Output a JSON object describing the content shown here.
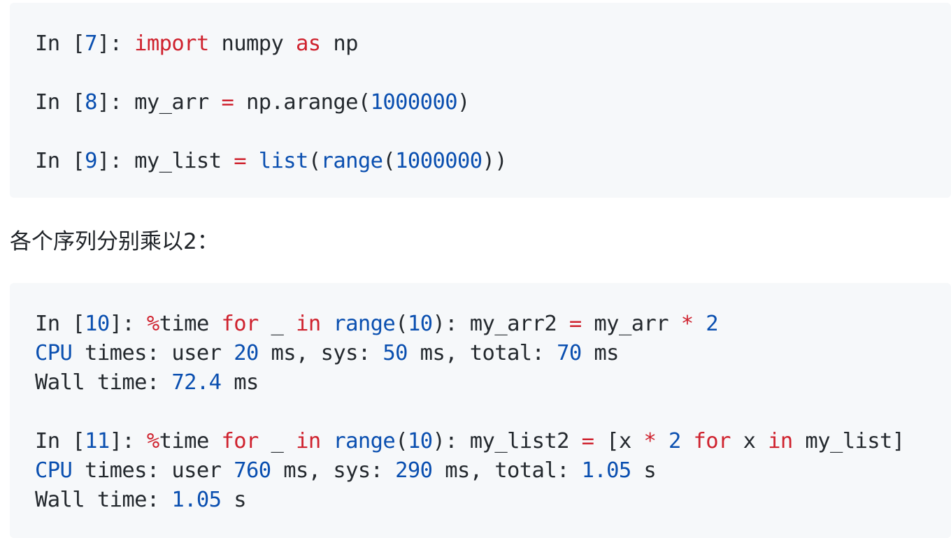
{
  "block1": {
    "lines": [
      [
        {
          "t": "In [",
          "c": "txt"
        },
        {
          "t": "7",
          "c": "num"
        },
        {
          "t": "]: ",
          "c": "txt"
        },
        {
          "t": "import",
          "c": "kw"
        },
        {
          "t": " numpy ",
          "c": "txt"
        },
        {
          "t": "as",
          "c": "kw"
        },
        {
          "t": " np",
          "c": "txt"
        }
      ],
      [],
      [
        {
          "t": "In [",
          "c": "txt"
        },
        {
          "t": "8",
          "c": "num"
        },
        {
          "t": "]: my_arr ",
          "c": "txt"
        },
        {
          "t": "=",
          "c": "op"
        },
        {
          "t": " np.arange(",
          "c": "txt"
        },
        {
          "t": "1000000",
          "c": "num"
        },
        {
          "t": ")",
          "c": "txt"
        }
      ],
      [],
      [
        {
          "t": "In [",
          "c": "txt"
        },
        {
          "t": "9",
          "c": "num"
        },
        {
          "t": "]: my_list ",
          "c": "txt"
        },
        {
          "t": "=",
          "c": "op"
        },
        {
          "t": " ",
          "c": "txt"
        },
        {
          "t": "list",
          "c": "bi"
        },
        {
          "t": "(",
          "c": "txt"
        },
        {
          "t": "range",
          "c": "bi"
        },
        {
          "t": "(",
          "c": "txt"
        },
        {
          "t": "1000000",
          "c": "num"
        },
        {
          "t": "))",
          "c": "txt"
        }
      ]
    ]
  },
  "paragraph": "各个序列分别乘以2：",
  "block2": {
    "lines": [
      [
        {
          "t": "In [",
          "c": "txt"
        },
        {
          "t": "10",
          "c": "num"
        },
        {
          "t": "]: ",
          "c": "txt"
        },
        {
          "t": "%",
          "c": "kw"
        },
        {
          "t": "time ",
          "c": "txt"
        },
        {
          "t": "for",
          "c": "kw"
        },
        {
          "t": " _ ",
          "c": "txt"
        },
        {
          "t": "in",
          "c": "kw"
        },
        {
          "t": " ",
          "c": "txt"
        },
        {
          "t": "range",
          "c": "bi"
        },
        {
          "t": "(",
          "c": "txt"
        },
        {
          "t": "10",
          "c": "num"
        },
        {
          "t": "): my_arr2 ",
          "c": "txt"
        },
        {
          "t": "=",
          "c": "op"
        },
        {
          "t": " my_arr ",
          "c": "txt"
        },
        {
          "t": "*",
          "c": "op"
        },
        {
          "t": " ",
          "c": "txt"
        },
        {
          "t": "2",
          "c": "num"
        }
      ],
      [
        {
          "t": "CPU",
          "c": "bi"
        },
        {
          "t": " times: user ",
          "c": "txt"
        },
        {
          "t": "20",
          "c": "num"
        },
        {
          "t": " ms, sys: ",
          "c": "txt"
        },
        {
          "t": "50",
          "c": "num"
        },
        {
          "t": " ms, total: ",
          "c": "txt"
        },
        {
          "t": "70",
          "c": "num"
        },
        {
          "t": " ms",
          "c": "txt"
        }
      ],
      [
        {
          "t": "Wall time: ",
          "c": "txt"
        },
        {
          "t": "72.4",
          "c": "num"
        },
        {
          "t": " ms",
          "c": "txt"
        }
      ],
      [],
      [
        {
          "t": "In [",
          "c": "txt"
        },
        {
          "t": "11",
          "c": "num"
        },
        {
          "t": "]: ",
          "c": "txt"
        },
        {
          "t": "%",
          "c": "kw"
        },
        {
          "t": "time ",
          "c": "txt"
        },
        {
          "t": "for",
          "c": "kw"
        },
        {
          "t": " _ ",
          "c": "txt"
        },
        {
          "t": "in",
          "c": "kw"
        },
        {
          "t": " ",
          "c": "txt"
        },
        {
          "t": "range",
          "c": "bi"
        },
        {
          "t": "(",
          "c": "txt"
        },
        {
          "t": "10",
          "c": "num"
        },
        {
          "t": "): my_list2 ",
          "c": "txt"
        },
        {
          "t": "=",
          "c": "op"
        },
        {
          "t": " [x ",
          "c": "txt"
        },
        {
          "t": "*",
          "c": "op"
        },
        {
          "t": " ",
          "c": "txt"
        },
        {
          "t": "2",
          "c": "num"
        },
        {
          "t": " ",
          "c": "txt"
        },
        {
          "t": "for",
          "c": "kw"
        },
        {
          "t": " x ",
          "c": "txt"
        },
        {
          "t": "in",
          "c": "kw"
        },
        {
          "t": " my_list]",
          "c": "txt"
        }
      ],
      [
        {
          "t": "CPU",
          "c": "bi"
        },
        {
          "t": " times: user ",
          "c": "txt"
        },
        {
          "t": "760",
          "c": "num"
        },
        {
          "t": " ms, sys: ",
          "c": "txt"
        },
        {
          "t": "290",
          "c": "num"
        },
        {
          "t": " ms, total: ",
          "c": "txt"
        },
        {
          "t": "1.05",
          "c": "num"
        },
        {
          "t": " s",
          "c": "txt"
        }
      ],
      [
        {
          "t": "Wall time: ",
          "c": "txt"
        },
        {
          "t": "1.05",
          "c": "num"
        },
        {
          "t": " s",
          "c": "txt"
        }
      ]
    ]
  },
  "colors": {
    "keyword": "#cf222e",
    "number": "#0a4fb0",
    "builtin": "#0a4fb0",
    "text": "#24292e",
    "code_background": "#f6f8fa"
  }
}
